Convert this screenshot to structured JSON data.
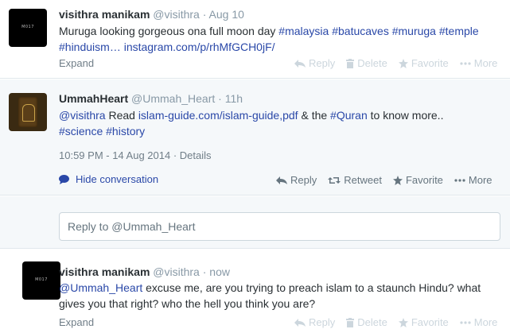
{
  "tweets": [
    {
      "avatar_text": "M017",
      "name": "visithra manikam",
      "handle": "@visithra",
      "time": "Aug 10",
      "line1": "Muruga looking gorgeous ona full moon day ",
      "line1_tags": "#malaysia #batucaves #muruga #temple",
      "line2_tags": "#hinduism… ",
      "line2_link": "instagram.com/p/rhMfGCH0jF/",
      "expand": "Expand",
      "actions": {
        "reply": "Reply",
        "delete": "Delete",
        "favorite": "Favorite",
        "more": "More"
      }
    },
    {
      "name": "UmmahHeart",
      "handle": "@Ummah_Heart",
      "time": "11h",
      "mention": "@visithra",
      "text_a": " Read ",
      "link": "islam-guide.com/islam-guide,pdf",
      "text_b": " & the ",
      "tag_quran": "#Quran",
      "text_c": " to know more..",
      "tags2": "#science #history",
      "timestamp": "10:59 PM - 14 Aug 2014",
      "details": "Details",
      "hide_conversation": "Hide conversation",
      "actions": {
        "reply": "Reply",
        "retweet": "Retweet",
        "favorite": "Favorite",
        "more": "More"
      }
    },
    {
      "avatar_text": "M017",
      "name": "visithra manikam",
      "handle": "@visithra",
      "time": "now",
      "mention": "@Ummah_Heart",
      "text_line1": " excuse me, are you trying to preach islam to a staunch Hindu? what",
      "text_line2": "gives you that right? who the hell you think you are?",
      "expand": "Expand",
      "actions": {
        "reply": "Reply",
        "delete": "Delete",
        "favorite": "Favorite",
        "more": "More"
      }
    }
  ],
  "reply_box": {
    "text": "Reply to @Ummah_Heart"
  },
  "colors": {
    "link": "#2a48a8",
    "muted": "#8899a6",
    "bg_alt": "#f5f8fa"
  }
}
